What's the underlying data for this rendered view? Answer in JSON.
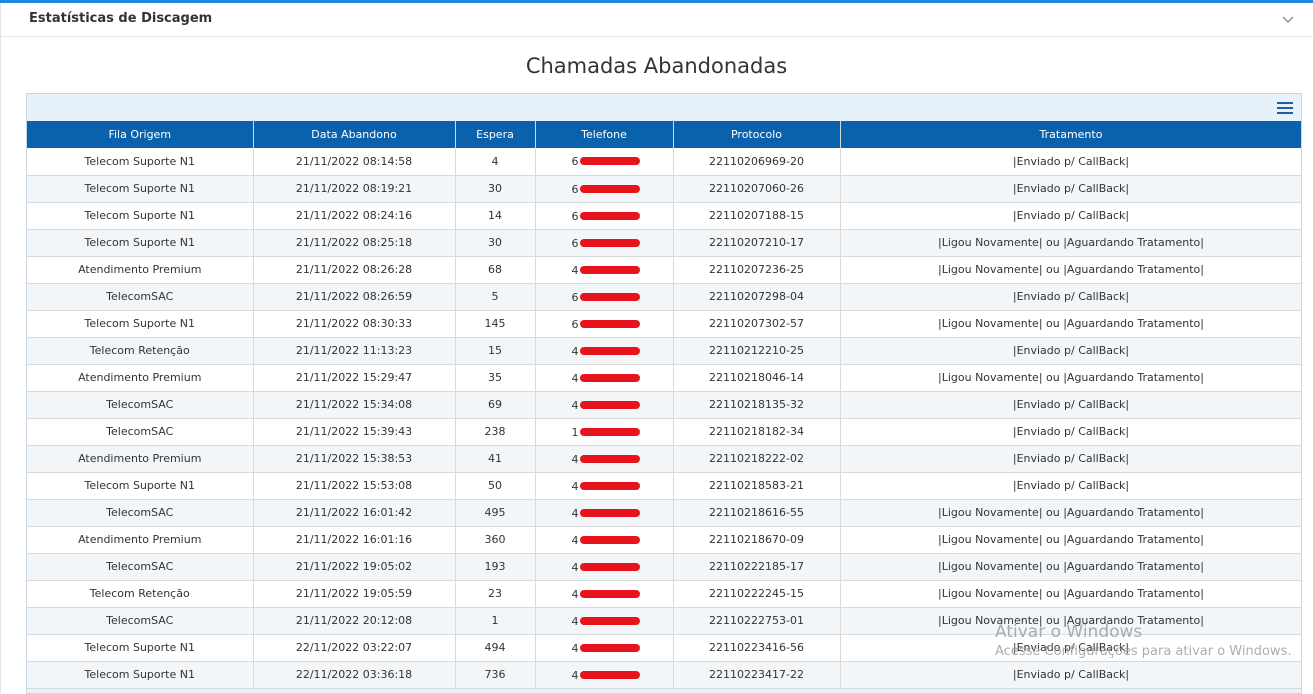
{
  "panel": {
    "title": "Estatísticas de Discagem",
    "collapse_icon": "chevron-down-icon"
  },
  "report": {
    "title": "Chamadas Abandonadas",
    "menu_icon": "hamburger-menu-icon"
  },
  "table": {
    "columns": [
      "Fila Origem",
      "Data Abandono",
      "Espera",
      "Telefone",
      "Protocolo",
      "Tratamento"
    ],
    "rows": [
      {
        "fila": "Telecom Suporte N1",
        "data": "21/11/2022 08:14:58",
        "espera": "4",
        "telefone": "6",
        "protocolo": "22110206969-20",
        "tratamento": "|Enviado p/ CallBack|"
      },
      {
        "fila": "Telecom Suporte N1",
        "data": "21/11/2022 08:19:21",
        "espera": "30",
        "telefone": "6",
        "protocolo": "22110207060-26",
        "tratamento": "|Enviado p/ CallBack|"
      },
      {
        "fila": "Telecom Suporte N1",
        "data": "21/11/2022 08:24:16",
        "espera": "14",
        "telefone": "6",
        "protocolo": "22110207188-15",
        "tratamento": "|Enviado p/ CallBack|"
      },
      {
        "fila": "Telecom Suporte N1",
        "data": "21/11/2022 08:25:18",
        "espera": "30",
        "telefone": "6",
        "protocolo": "22110207210-17",
        "tratamento": "|Ligou Novamente| ou |Aguardando Tratamento|"
      },
      {
        "fila": "Atendimento Premium",
        "data": "21/11/2022 08:26:28",
        "espera": "68",
        "telefone": "4",
        "protocolo": "22110207236-25",
        "tratamento": "|Ligou Novamente| ou |Aguardando Tratamento|"
      },
      {
        "fila": "TelecomSAC",
        "data": "21/11/2022 08:26:59",
        "espera": "5",
        "telefone": "6",
        "protocolo": "22110207298-04",
        "tratamento": "|Enviado p/ CallBack|"
      },
      {
        "fila": "Telecom Suporte N1",
        "data": "21/11/2022 08:30:33",
        "espera": "145",
        "telefone": "6",
        "protocolo": "22110207302-57",
        "tratamento": "|Ligou Novamente| ou |Aguardando Tratamento|"
      },
      {
        "fila": "Telecom Retenção",
        "data": "21/11/2022 11:13:23",
        "espera": "15",
        "telefone": "4",
        "protocolo": "22110212210-25",
        "tratamento": "|Enviado p/ CallBack|"
      },
      {
        "fila": "Atendimento Premium",
        "data": "21/11/2022 15:29:47",
        "espera": "35",
        "telefone": "4",
        "protocolo": "22110218046-14",
        "tratamento": "|Ligou Novamente| ou |Aguardando Tratamento|"
      },
      {
        "fila": "TelecomSAC",
        "data": "21/11/2022 15:34:08",
        "espera": "69",
        "telefone": "4",
        "protocolo": "22110218135-32",
        "tratamento": "|Enviado p/ CallBack|"
      },
      {
        "fila": "TelecomSAC",
        "data": "21/11/2022 15:39:43",
        "espera": "238",
        "telefone": "1",
        "protocolo": "22110218182-34",
        "tratamento": "|Enviado p/ CallBack|"
      },
      {
        "fila": "Atendimento Premium",
        "data": "21/11/2022 15:38:53",
        "espera": "41",
        "telefone": "4",
        "protocolo": "22110218222-02",
        "tratamento": "|Enviado p/ CallBack|"
      },
      {
        "fila": "Telecom Suporte N1",
        "data": "21/11/2022 15:53:08",
        "espera": "50",
        "telefone": "4",
        "protocolo": "22110218583-21",
        "tratamento": "|Enviado p/ CallBack|"
      },
      {
        "fila": "TelecomSAC",
        "data": "21/11/2022 16:01:42",
        "espera": "495",
        "telefone": "4",
        "protocolo": "22110218616-55",
        "tratamento": "|Ligou Novamente| ou |Aguardando Tratamento|"
      },
      {
        "fila": "Atendimento Premium",
        "data": "21/11/2022 16:01:16",
        "espera": "360",
        "telefone": "4",
        "protocolo": "22110218670-09",
        "tratamento": "|Ligou Novamente| ou |Aguardando Tratamento|"
      },
      {
        "fila": "TelecomSAC",
        "data": "21/11/2022 19:05:02",
        "espera": "193",
        "telefone": "4",
        "protocolo": "22110222185-17",
        "tratamento": "|Ligou Novamente| ou |Aguardando Tratamento|"
      },
      {
        "fila": "Telecom Retenção",
        "data": "21/11/2022 19:05:59",
        "espera": "23",
        "telefone": "4",
        "protocolo": "22110222245-15",
        "tratamento": "|Ligou Novamente| ou |Aguardando Tratamento|"
      },
      {
        "fila": "TelecomSAC",
        "data": "21/11/2022 20:12:08",
        "espera": "1",
        "telefone": "4",
        "protocolo": "22110222753-01",
        "tratamento": "|Ligou Novamente| ou |Aguardando Tratamento|"
      },
      {
        "fila": "Telecom Suporte N1",
        "data": "22/11/2022 03:22:07",
        "espera": "494",
        "telefone": "4",
        "protocolo": "22110223416-56",
        "tratamento": "|Enviado p/ CallBack|"
      },
      {
        "fila": "Telecom Suporte N1",
        "data": "22/11/2022 03:36:18",
        "espera": "736",
        "telefone": "4",
        "protocolo": "22110223417-22",
        "tratamento": "|Enviado p/ CallBack|"
      }
    ]
  },
  "watermark": {
    "title": "Ativar o Windows",
    "subtitle": "Acesse Configurações para ativar o Windows."
  },
  "colors": {
    "accent": "#1e88e5",
    "header_bg": "#0a62ad",
    "redaction": "#e8141d"
  }
}
